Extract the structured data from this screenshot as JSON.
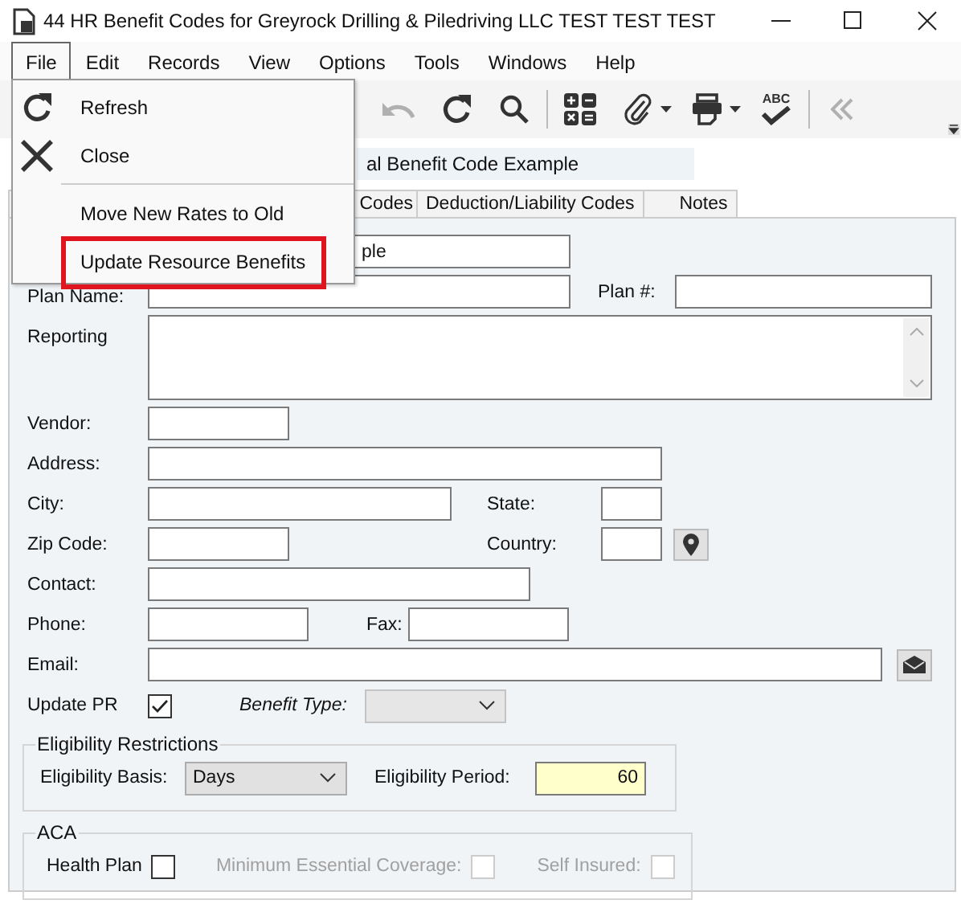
{
  "window": {
    "title": "44 HR Benefit Codes for Greyrock Drilling & Piledriving LLC TEST TEST TEST"
  },
  "menu_bar": [
    {
      "label": "File",
      "selected": true
    },
    {
      "label": "Edit",
      "selected": false
    },
    {
      "label": "Records",
      "selected": false
    },
    {
      "label": "View",
      "selected": false
    },
    {
      "label": "Options",
      "selected": false
    },
    {
      "label": "Tools",
      "selected": false
    },
    {
      "label": "Windows",
      "selected": false
    },
    {
      "label": "Help",
      "selected": false
    }
  ],
  "file_menu": [
    {
      "kind": "refresh",
      "label": "Refresh",
      "highlighted": false
    },
    {
      "kind": "close",
      "label": "Close",
      "highlighted": false
    },
    {
      "kind": "separator"
    },
    {
      "kind": "item",
      "label": "Move New Rates to Old",
      "highlighted": false
    },
    {
      "kind": "item",
      "label": "Update Resource Benefits",
      "highlighted": true
    }
  ],
  "toolbar": [
    {
      "kind": "undo",
      "disabled": true
    },
    {
      "kind": "redo",
      "disabled": false
    },
    {
      "kind": "search",
      "disabled": false
    },
    {
      "kind": "divider"
    },
    {
      "kind": "calculator",
      "disabled": false
    },
    {
      "kind": "paperclip",
      "disabled": false
    },
    {
      "kind": "caret",
      "disabled": false
    },
    {
      "kind": "printer",
      "disabled": false
    },
    {
      "kind": "caret",
      "disabled": false
    },
    {
      "kind": "spellcheck",
      "label": "ABC",
      "disabled": false
    },
    {
      "kind": "divider"
    },
    {
      "kind": "collapse",
      "disabled": true
    }
  ],
  "header_field": {
    "value": "al Benefit Code Example"
  },
  "tabs": [
    {
      "label": "Codes",
      "selected": false
    },
    {
      "label": "Deduction/Liability Codes",
      "selected": false
    },
    {
      "label": "Notes",
      "selected": false
    }
  ],
  "form": {
    "description": {
      "value": "ple"
    },
    "plan_name": {
      "label": "Plan Name:"
    },
    "plan_number": {
      "label": "Plan #:"
    },
    "reporting": {
      "label": "Reporting"
    },
    "vendor": {
      "label": "Vendor:"
    },
    "address": {
      "label": "Address:"
    },
    "city": {
      "label": "City:"
    },
    "state": {
      "label": "State:"
    },
    "zip_code": {
      "label": "Zip Code:"
    },
    "country": {
      "label": "Country:"
    },
    "contact": {
      "label": "Contact:"
    },
    "phone": {
      "label": "Phone:"
    },
    "fax": {
      "label": "Fax:"
    },
    "email": {
      "label": "Email:"
    },
    "update_pr": {
      "label": "Update PR",
      "checked": true
    },
    "benefit_type": {
      "label": "Benefit Type:",
      "disabled": true
    }
  },
  "eligibility": {
    "title": "Eligibility Restrictions",
    "basis_label": "Eligibility Basis:",
    "basis": "Days",
    "period_label": "Eligibility Period:",
    "period": "60"
  },
  "aca": {
    "title": "ACA",
    "checks": [
      {
        "label": "Health Plan",
        "checked": false,
        "disabled": false
      },
      {
        "label": "Minimum Essential Coverage:",
        "checked": false,
        "disabled": true
      },
      {
        "label": "Self Insured:",
        "checked": false,
        "disabled": true
      }
    ]
  }
}
